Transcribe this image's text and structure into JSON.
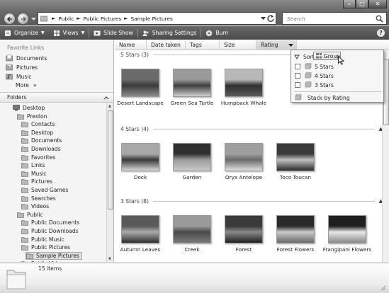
{
  "window": {
    "minimize_glyph": "–",
    "maximize_glyph": "□",
    "close_glyph": "✕"
  },
  "address": {
    "crumbs": [
      "Public",
      "Public Pictures",
      "Sample Pictures"
    ],
    "separator": "►"
  },
  "search": {
    "placeholder": "Search"
  },
  "toolbar": {
    "organize": "Organize",
    "views": "Views",
    "slideshow": "Slide Show",
    "sharing": "Sharing Settings",
    "burn": "Burn",
    "help": "?"
  },
  "favorites": {
    "title": "Favorite Links",
    "items": [
      "Documents",
      "Pictures",
      "Music"
    ],
    "more": "More",
    "more_arrow": "»"
  },
  "folders": {
    "title": "Folders",
    "tree": [
      {
        "label": "Desktop",
        "depth": 0
      },
      {
        "label": "Preston",
        "depth": 1
      },
      {
        "label": "Contacts",
        "depth": 2
      },
      {
        "label": "Desktop",
        "depth": 2
      },
      {
        "label": "Documents",
        "depth": 2
      },
      {
        "label": "Downloads",
        "depth": 2
      },
      {
        "label": "Favorites",
        "depth": 2
      },
      {
        "label": "Links",
        "depth": 2
      },
      {
        "label": "Music",
        "depth": 2
      },
      {
        "label": "Pictures",
        "depth": 2
      },
      {
        "label": "Saved Games",
        "depth": 2
      },
      {
        "label": "Searches",
        "depth": 2
      },
      {
        "label": "Videos",
        "depth": 2
      },
      {
        "label": "Public",
        "depth": 1
      },
      {
        "label": "Public Documents",
        "depth": 2
      },
      {
        "label": "Public Downloads",
        "depth": 2
      },
      {
        "label": "Public Music",
        "depth": 2
      },
      {
        "label": "Public Pictures",
        "depth": 2
      },
      {
        "label": "Sample Pictures",
        "depth": 3
      },
      {
        "label": "Public Videos",
        "depth": 2
      }
    ],
    "selected": "Sample Pictures"
  },
  "columns": [
    "Name",
    "Date taken",
    "Tags",
    "Size",
    "Rating"
  ],
  "groups": [
    {
      "header": "5 Stars (3)",
      "items": [
        "Desert Landscape",
        "Green Sea Turtle",
        "Humpback Whale"
      ]
    },
    {
      "header": "4 Stars (4)",
      "items": [
        "Dock",
        "Garden",
        "Oryx Antelope",
        "Toco Toucan"
      ]
    },
    {
      "header": "3 Stars (8)",
      "items": [
        "Autumn Leaves",
        "Creek",
        "Forest",
        "Forest Flowers",
        "Frangipani Flowers"
      ]
    }
  ],
  "menu": {
    "sort": "Sort",
    "group": "Group",
    "options": [
      "5 Stars",
      "4 Stars",
      "3 Stars"
    ],
    "stack": "Stack by Rating"
  },
  "status": {
    "count": "15 items"
  }
}
